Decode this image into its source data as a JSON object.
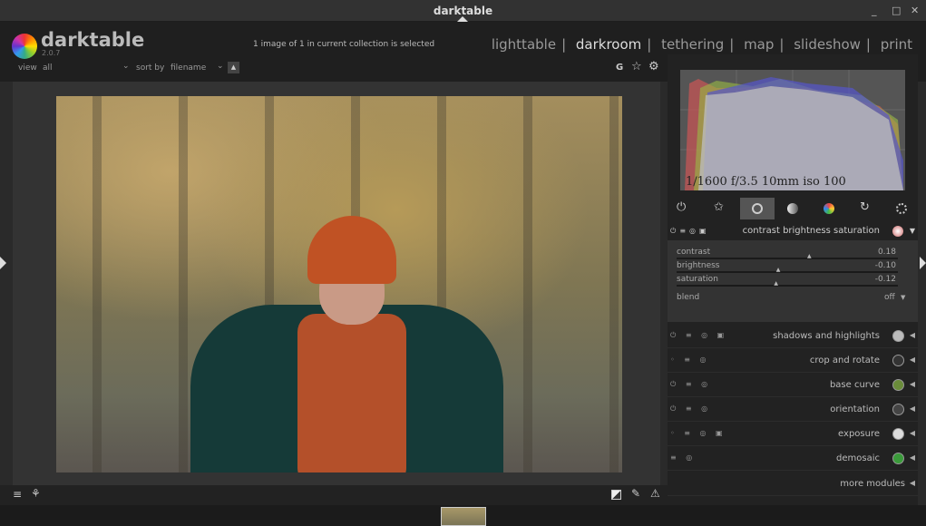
{
  "window": {
    "title": "darktable",
    "min": "_",
    "max": "□",
    "close": "✕"
  },
  "header": {
    "app": "darktable",
    "version": "2.0.7",
    "status": "1 image of 1 in current collection is selected",
    "view_label": "view",
    "view_value": "all",
    "sort_label": "sort by",
    "sort_value": "filename",
    "views": [
      "lighttable",
      "darkroom",
      "tethering",
      "map",
      "slideshow",
      "print"
    ],
    "active_view": "darkroom",
    "sep": "|",
    "top_icons": {
      "grouping": "G",
      "star": "☆",
      "gear": "⚙"
    }
  },
  "histogram": {
    "exif": "1/1600 f/3.5 10mm iso 100"
  },
  "module_groups": [
    "power-icon",
    "favorite-icon",
    "basic-icon",
    "tone-icon",
    "color-icon",
    "correct-icon",
    "effect-icon"
  ],
  "active_group": 2,
  "expanded_module": {
    "name": "contrast brightness saturation",
    "sliders": [
      {
        "label": "contrast",
        "value": "0.18",
        "pos": 0.59
      },
      {
        "label": "brightness",
        "value": "-0.10",
        "pos": 0.45
      },
      {
        "label": "saturation",
        "value": "-0.12",
        "pos": 0.44
      }
    ],
    "blend_label": "blend",
    "blend_value": "off"
  },
  "modules": [
    {
      "name": "shadows and highlights",
      "icon": "sphere-icon",
      "color": "#bbbbbb",
      "flags": "⏻ ≡ ◎ ▣"
    },
    {
      "name": "crop and rotate",
      "icon": "crop-icon",
      "color": "#333333",
      "flags": "◦ ≡ ◎"
    },
    {
      "name": "base curve",
      "icon": "curve-icon",
      "color": "#6a8c3a",
      "flags": "⏻ ≡ ◎"
    },
    {
      "name": "orientation",
      "icon": "orientation-icon",
      "color": "#444444",
      "flags": "⏻ ≡ ◎"
    },
    {
      "name": "exposure",
      "icon": "exposure-icon",
      "color": "#dddddd",
      "flags": "◦ ≡ ◎ ▣"
    },
    {
      "name": "demosaic",
      "icon": "demosaic-icon",
      "color": "#3a9a3a",
      "flags": "≡ ◎"
    }
  ],
  "more_modules": "more modules"
}
